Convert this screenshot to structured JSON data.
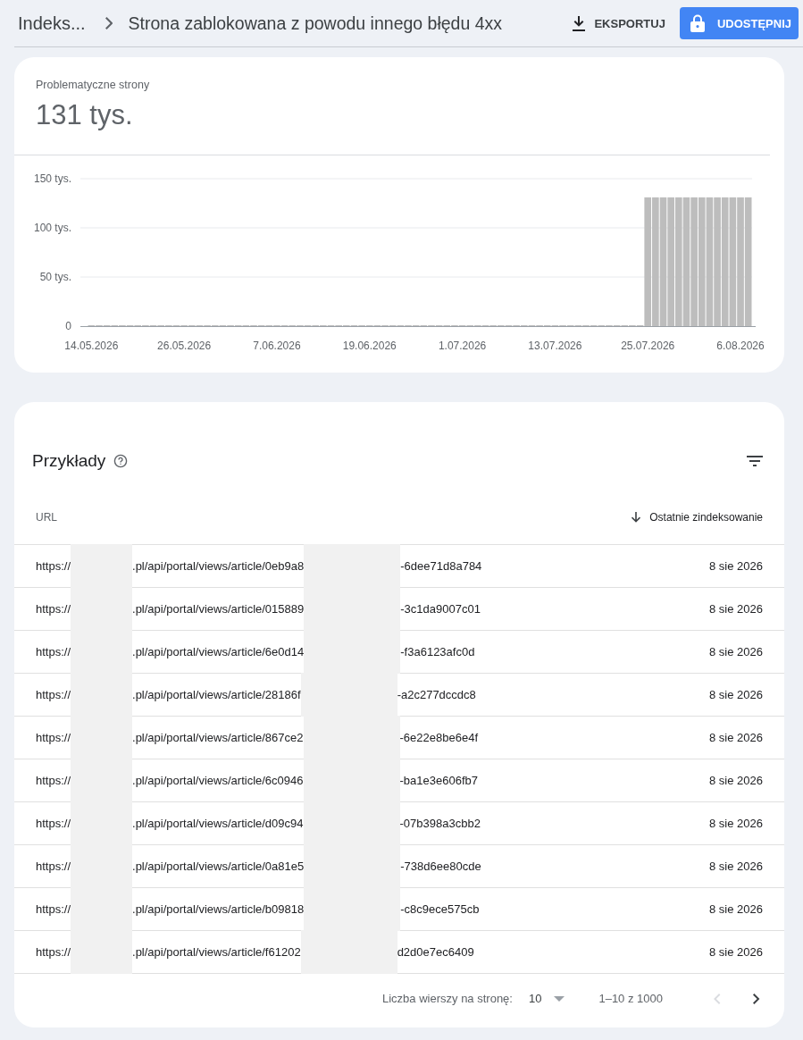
{
  "header": {
    "breadcrumb": "Indeks...",
    "title": "Strona zablokowana z powodu innego błędu 4xx",
    "export_label": "EKSPORTUJ",
    "share_label": "UDOSTĘPNIJ"
  },
  "summary": {
    "label": "Problematyczne strony",
    "value": "131 tys."
  },
  "chart_data": {
    "type": "bar",
    "categories": [
      "14.05.2026",
      null,
      null,
      null,
      null,
      null,
      null,
      null,
      null,
      null,
      null,
      null,
      "26.05.2026",
      null,
      null,
      null,
      null,
      null,
      null,
      null,
      null,
      null,
      null,
      null,
      "7.06.2026",
      null,
      null,
      null,
      null,
      null,
      null,
      null,
      null,
      null,
      null,
      null,
      "19.06.2026",
      null,
      null,
      null,
      null,
      null,
      null,
      null,
      null,
      null,
      null,
      null,
      "1.07.2026",
      null,
      null,
      null,
      null,
      null,
      null,
      null,
      null,
      null,
      null,
      null,
      "13.07.2026",
      null,
      null,
      null,
      null,
      null,
      null,
      null,
      null,
      null,
      null,
      null,
      "25.07.2026",
      null,
      null,
      null,
      null,
      null,
      null,
      null,
      null,
      null,
      null,
      null,
      "6.08.2026",
      null
    ],
    "series": [
      {
        "color": "#bdbdbd",
        "values": [
          0,
          0,
          0,
          0,
          0,
          0,
          0,
          0,
          0,
          0,
          0,
          0,
          0,
          0,
          0,
          0,
          0,
          0,
          0,
          0,
          0,
          0,
          0,
          0,
          0,
          0,
          0,
          0,
          0,
          0,
          0,
          0,
          0,
          0,
          0,
          0,
          0,
          0,
          0,
          0,
          0,
          0,
          0,
          0,
          0,
          0,
          0,
          0,
          0,
          0,
          0,
          0,
          0,
          0,
          0,
          0,
          0,
          0,
          0,
          0,
          0,
          0,
          0,
          0,
          0,
          0,
          0,
          0,
          0,
          0,
          0,
          0,
          131,
          131,
          131,
          131,
          131,
          131,
          131,
          131,
          131,
          131,
          131,
          131,
          131,
          131
        ]
      }
    ],
    "ylim": [
      0,
      150
    ],
    "yticks": [
      0,
      {
        "value": 50,
        "label": "50 tys."
      },
      {
        "value": 100,
        "label": "100 tys."
      },
      {
        "value": 150,
        "label": "150 tys."
      }
    ]
  },
  "examples": {
    "title": "Przykłady",
    "columns": [
      {
        "label": "URL",
        "sorted": false
      },
      {
        "label": "Ostatnie zindeksowanie",
        "sorted": true
      }
    ],
    "rows": [
      {
        "url_parts": [
          "https://",
          ".pl/api/portal/views/article/0eb9a8",
          "-6dee71d8a784"
        ],
        "date": "8 sie 2026"
      },
      {
        "url_parts": [
          "https://",
          ".pl/api/portal/views/article/015889",
          "-3c1da9007c01"
        ],
        "date": "8 sie 2026"
      },
      {
        "url_parts": [
          "https://",
          ".pl/api/portal/views/article/6e0d14",
          "-f3a6123afc0d"
        ],
        "date": "8 sie 2026"
      },
      {
        "url_parts": [
          "https://",
          ".pl/api/portal/views/article/28186f",
          "-a2c277dccdc8"
        ],
        "date": "8 sie 2026"
      },
      {
        "url_parts": [
          "https://",
          ".pl/api/portal/views/article/867ce2",
          "-6e22e8be6e4f"
        ],
        "date": "8 sie 2026"
      },
      {
        "url_parts": [
          "https://",
          ".pl/api/portal/views/article/6c0946",
          "-ba1e3e606fb7"
        ],
        "date": "8 sie 2026"
      },
      {
        "url_parts": [
          "https://",
          ".pl/api/portal/views/article/d09c94",
          "-07b398a3cbb2"
        ],
        "date": "8 sie 2026"
      },
      {
        "url_parts": [
          "https://",
          ".pl/api/portal/views/article/0a81e5",
          "-738d6ee80cde"
        ],
        "date": "8 sie 2026"
      },
      {
        "url_parts": [
          "https://",
          ".pl/api/portal/views/article/b09818",
          "-c8c9ece575cb"
        ],
        "date": "8 sie 2026"
      },
      {
        "url_parts": [
          "https://",
          ".pl/api/portal/views/article/f61202",
          "d2d0e7ec6409"
        ],
        "date": "8 sie 2026"
      }
    ],
    "pagination": {
      "rows_label": "Liczba wierszy na stronę:",
      "rows_value": "10",
      "range": "1–10 z 1000",
      "prev_disabled": true,
      "next_disabled": false
    }
  }
}
